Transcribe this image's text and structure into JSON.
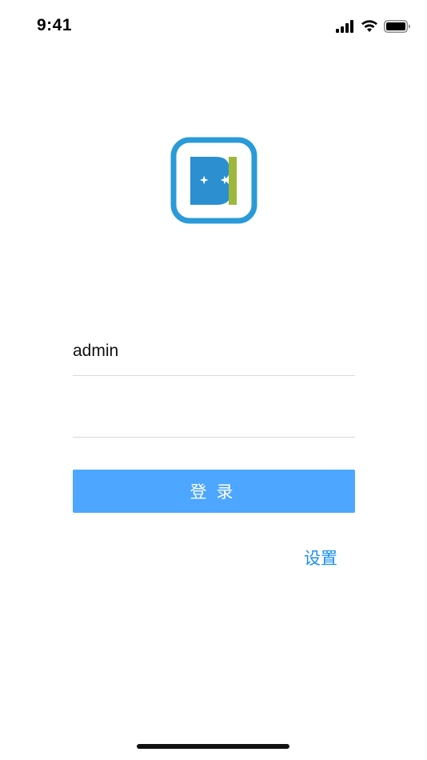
{
  "status_bar": {
    "time": "9:41",
    "icons": [
      "cellular-signal-icon",
      "wifi-icon",
      "battery-icon"
    ]
  },
  "logo": {
    "text": "BI",
    "colors": {
      "frame": "#2a9ad8",
      "letter_b": "#2b8fd0",
      "letter_i": "#9db83a"
    }
  },
  "login_form": {
    "username_value": "admin",
    "password_value": "",
    "login_label": "登录",
    "settings_label": "设置"
  },
  "colors": {
    "primary_button": "#4da6ff",
    "link": "#1a8ef0",
    "divider": "#d9d9d9"
  }
}
